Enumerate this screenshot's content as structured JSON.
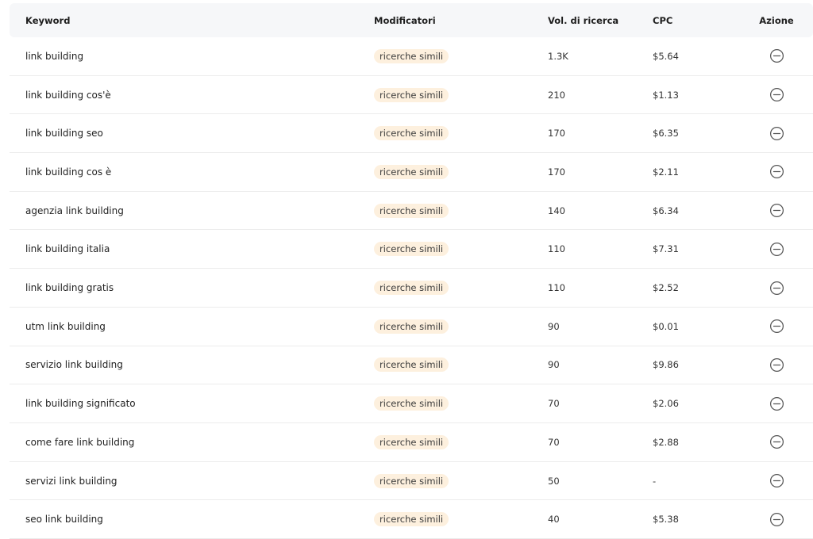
{
  "table": {
    "headers": {
      "keyword": "Keyword",
      "modifiers": "Modificatori",
      "volume": "Vol. di ricerca",
      "cpc": "CPC",
      "action": "Azione"
    },
    "action_icon": "minus-circle-icon",
    "badge_color": "#fdf0de",
    "rows": [
      {
        "keyword": "link building",
        "modifier": "ricerche simili",
        "volume": "1.3K",
        "cpc": "$5.64"
      },
      {
        "keyword": "link building cos'è",
        "modifier": "ricerche simili",
        "volume": "210",
        "cpc": "$1.13"
      },
      {
        "keyword": "link building seo",
        "modifier": "ricerche simili",
        "volume": "170",
        "cpc": "$6.35"
      },
      {
        "keyword": "link building cos è",
        "modifier": "ricerche simili",
        "volume": "170",
        "cpc": "$2.11"
      },
      {
        "keyword": "agenzia link building",
        "modifier": "ricerche simili",
        "volume": "140",
        "cpc": "$6.34"
      },
      {
        "keyword": "link building italia",
        "modifier": "ricerche simili",
        "volume": "110",
        "cpc": "$7.31"
      },
      {
        "keyword": "link building gratis",
        "modifier": "ricerche simili",
        "volume": "110",
        "cpc": "$2.52"
      },
      {
        "keyword": "utm link building",
        "modifier": "ricerche simili",
        "volume": "90",
        "cpc": "$0.01"
      },
      {
        "keyword": "servizio link building",
        "modifier": "ricerche simili",
        "volume": "90",
        "cpc": "$9.86"
      },
      {
        "keyword": "link building significato",
        "modifier": "ricerche simili",
        "volume": "70",
        "cpc": "$2.06"
      },
      {
        "keyword": "come fare link building",
        "modifier": "ricerche simili",
        "volume": "70",
        "cpc": "$2.88"
      },
      {
        "keyword": "servizi link building",
        "modifier": "ricerche simili",
        "volume": "50",
        "cpc": "-"
      },
      {
        "keyword": "seo link building",
        "modifier": "ricerche simili",
        "volume": "40",
        "cpc": "$5.38"
      }
    ]
  }
}
